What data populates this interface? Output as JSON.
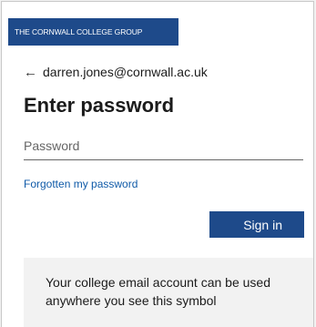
{
  "brand": {
    "logo_text": "THE CORNWALL COLLEGE GROUP"
  },
  "identity": {
    "back_symbol": "←",
    "email": "darren.jones@cornwall.ac.uk"
  },
  "title": "Enter password",
  "password_field": {
    "placeholder": "Password",
    "value": ""
  },
  "forgot_link": "Forgotten my password",
  "signin_button": "Sign in",
  "info_box": {
    "text": "Your college email account can be used anywhere you see this symbol"
  },
  "colors": {
    "brand_blue": "#1e4a8a",
    "link_blue": "#0f5aa8",
    "info_bg": "#f2f2f2"
  }
}
